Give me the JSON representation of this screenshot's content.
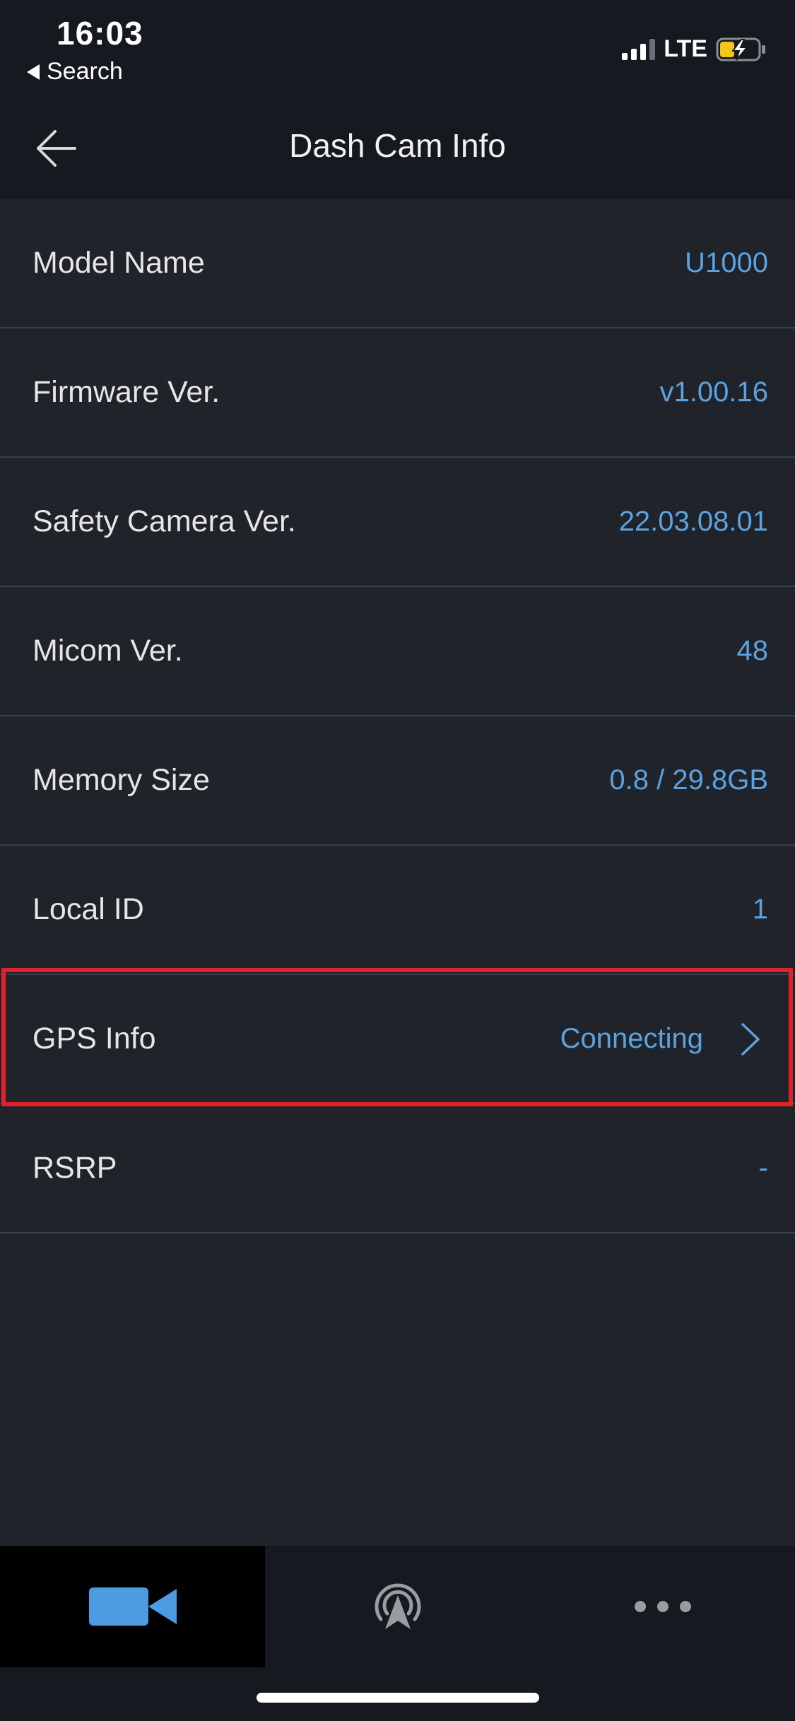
{
  "status_bar": {
    "time": "16:03",
    "back_label": "Search",
    "network": "LTE"
  },
  "nav": {
    "title": "Dash Cam Info",
    "back_icon": "arrow-left-icon"
  },
  "info_rows": [
    {
      "label": "Model Name",
      "value": "U1000"
    },
    {
      "label": "Firmware Ver.",
      "value": "v1.00.16"
    },
    {
      "label": "Safety Camera Ver.",
      "value": "22.03.08.01"
    },
    {
      "label": "Micom Ver.",
      "value": "48"
    },
    {
      "label": "Memory Size",
      "value": "0.8 / 29.8GB"
    },
    {
      "label": "Local ID",
      "value": "1"
    },
    {
      "label": "GPS Info",
      "value": "Connecting"
    },
    {
      "label": "RSRP",
      "value": "-"
    }
  ],
  "tabs": [
    {
      "icon": "video-camera-icon",
      "active": true
    },
    {
      "icon": "wireless-navigation-icon",
      "active": false
    },
    {
      "icon": "more-dots-icon",
      "active": false
    }
  ],
  "colors": {
    "background": "#20232a",
    "bar_background": "#161920",
    "value_text": "#5aa3e0",
    "highlight_border": "#e0212b",
    "divider": "#3a3e46"
  }
}
